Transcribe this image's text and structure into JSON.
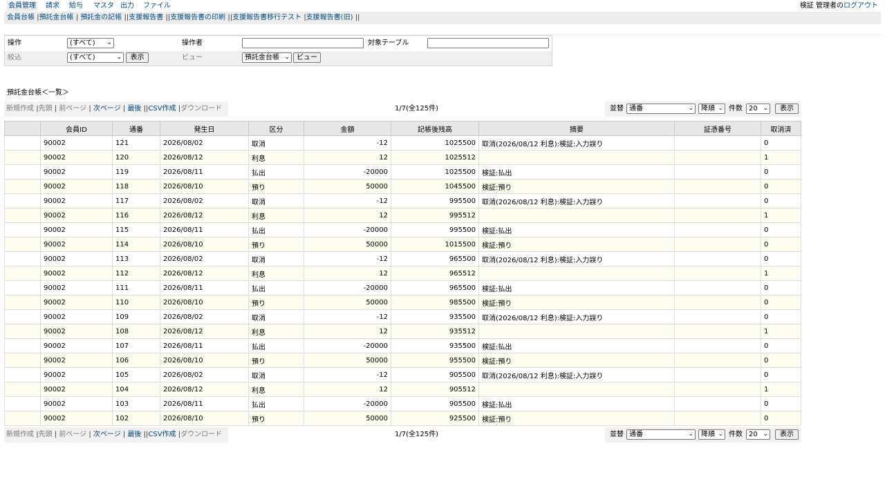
{
  "top_menu": [
    "会員管理",
    "請求",
    "給与",
    "マスタ",
    "出力",
    "ファイル"
  ],
  "login": {
    "user": "検証 管理者の",
    "logout": "ログアウト"
  },
  "sub_menu": [
    "会員台帳",
    "預託金台帳",
    "預託金の記帳",
    "支援報告書",
    "支援報告書の印刷",
    "支援報告書移行テスト",
    "支援報告書(旧)"
  ],
  "filter": {
    "operation_label": "操作",
    "operation_value": "(すべて)",
    "operator_label": "操作者",
    "target_table_label": "対象テーブル",
    "narrow_label": "絞込",
    "narrow_value": "(すべて)",
    "show_button": "表示",
    "view_label": "ビュー",
    "view_value": "預託金台帳",
    "view_button": "ビュー"
  },
  "list_title": "預託金台帳＜一覧＞",
  "pager": {
    "new": "新規作成",
    "first": "先頭",
    "prev": "前ページ",
    "next": "次ページ",
    "last": "最後",
    "csv": "CSV作成",
    "download": "ダウンロード",
    "info": "1/7(全125件)",
    "sort_label": "並替",
    "sort_value": "通番",
    "order_value": "降順",
    "count_label": "件数",
    "count_value": "20",
    "show_button": "表示"
  },
  "table": {
    "columns": [
      "",
      "会員ID",
      "通番",
      "発生日",
      "区分",
      "金額",
      "記帳後残高",
      "摘要",
      "証憑番号",
      "取消済"
    ],
    "rows": [
      [
        "",
        "90002",
        "121",
        "2026/08/02",
        "取消",
        "-12",
        "1025500",
        "取消(2026/08/12 利息):検証:入力誤り",
        "",
        "0"
      ],
      [
        "",
        "90002",
        "120",
        "2026/08/12",
        "利息",
        "12",
        "1025512",
        "",
        "",
        "1"
      ],
      [
        "",
        "90002",
        "119",
        "2026/08/11",
        "払出",
        "-20000",
        "1025500",
        "検証:払出",
        "",
        "0"
      ],
      [
        "",
        "90002",
        "118",
        "2026/08/10",
        "預り",
        "50000",
        "1045500",
        "検証:預り",
        "",
        "0"
      ],
      [
        "",
        "90002",
        "117",
        "2026/08/02",
        "取消",
        "-12",
        "995500",
        "取消(2026/08/12 利息):検証:入力誤り",
        "",
        "0"
      ],
      [
        "",
        "90002",
        "116",
        "2026/08/12",
        "利息",
        "12",
        "995512",
        "",
        "",
        "1"
      ],
      [
        "",
        "90002",
        "115",
        "2026/08/11",
        "払出",
        "-20000",
        "995500",
        "検証:払出",
        "",
        "0"
      ],
      [
        "",
        "90002",
        "114",
        "2026/08/10",
        "預り",
        "50000",
        "1015500",
        "検証:預り",
        "",
        "0"
      ],
      [
        "",
        "90002",
        "113",
        "2026/08/02",
        "取消",
        "-12",
        "965500",
        "取消(2026/08/12 利息):検証:入力誤り",
        "",
        "0"
      ],
      [
        "",
        "90002",
        "112",
        "2026/08/12",
        "利息",
        "12",
        "965512",
        "",
        "",
        "1"
      ],
      [
        "",
        "90002",
        "111",
        "2026/08/11",
        "払出",
        "-20000",
        "965500",
        "検証:払出",
        "",
        "0"
      ],
      [
        "",
        "90002",
        "110",
        "2026/08/10",
        "預り",
        "50000",
        "985500",
        "検証:預り",
        "",
        "0"
      ],
      [
        "",
        "90002",
        "109",
        "2026/08/02",
        "取消",
        "-12",
        "935500",
        "取消(2026/08/12 利息):検証:入力誤り",
        "",
        "0"
      ],
      [
        "",
        "90002",
        "108",
        "2026/08/12",
        "利息",
        "12",
        "935512",
        "",
        "",
        "1"
      ],
      [
        "",
        "90002",
        "107",
        "2026/08/11",
        "払出",
        "-20000",
        "935500",
        "検証:払出",
        "",
        "0"
      ],
      [
        "",
        "90002",
        "106",
        "2026/08/10",
        "預り",
        "50000",
        "955500",
        "検証:預り",
        "",
        "0"
      ],
      [
        "",
        "90002",
        "105",
        "2026/08/02",
        "取消",
        "-12",
        "905500",
        "取消(2026/08/12 利息):検証:入力誤り",
        "",
        "0"
      ],
      [
        "",
        "90002",
        "104",
        "2026/08/12",
        "利息",
        "12",
        "905512",
        "",
        "",
        "1"
      ],
      [
        "",
        "90002",
        "103",
        "2026/08/11",
        "払出",
        "-20000",
        "905500",
        "検証:払出",
        "",
        "0"
      ],
      [
        "",
        "90002",
        "102",
        "2026/08/10",
        "預り",
        "50000",
        "925500",
        "検証:預り",
        "",
        "0"
      ]
    ]
  }
}
